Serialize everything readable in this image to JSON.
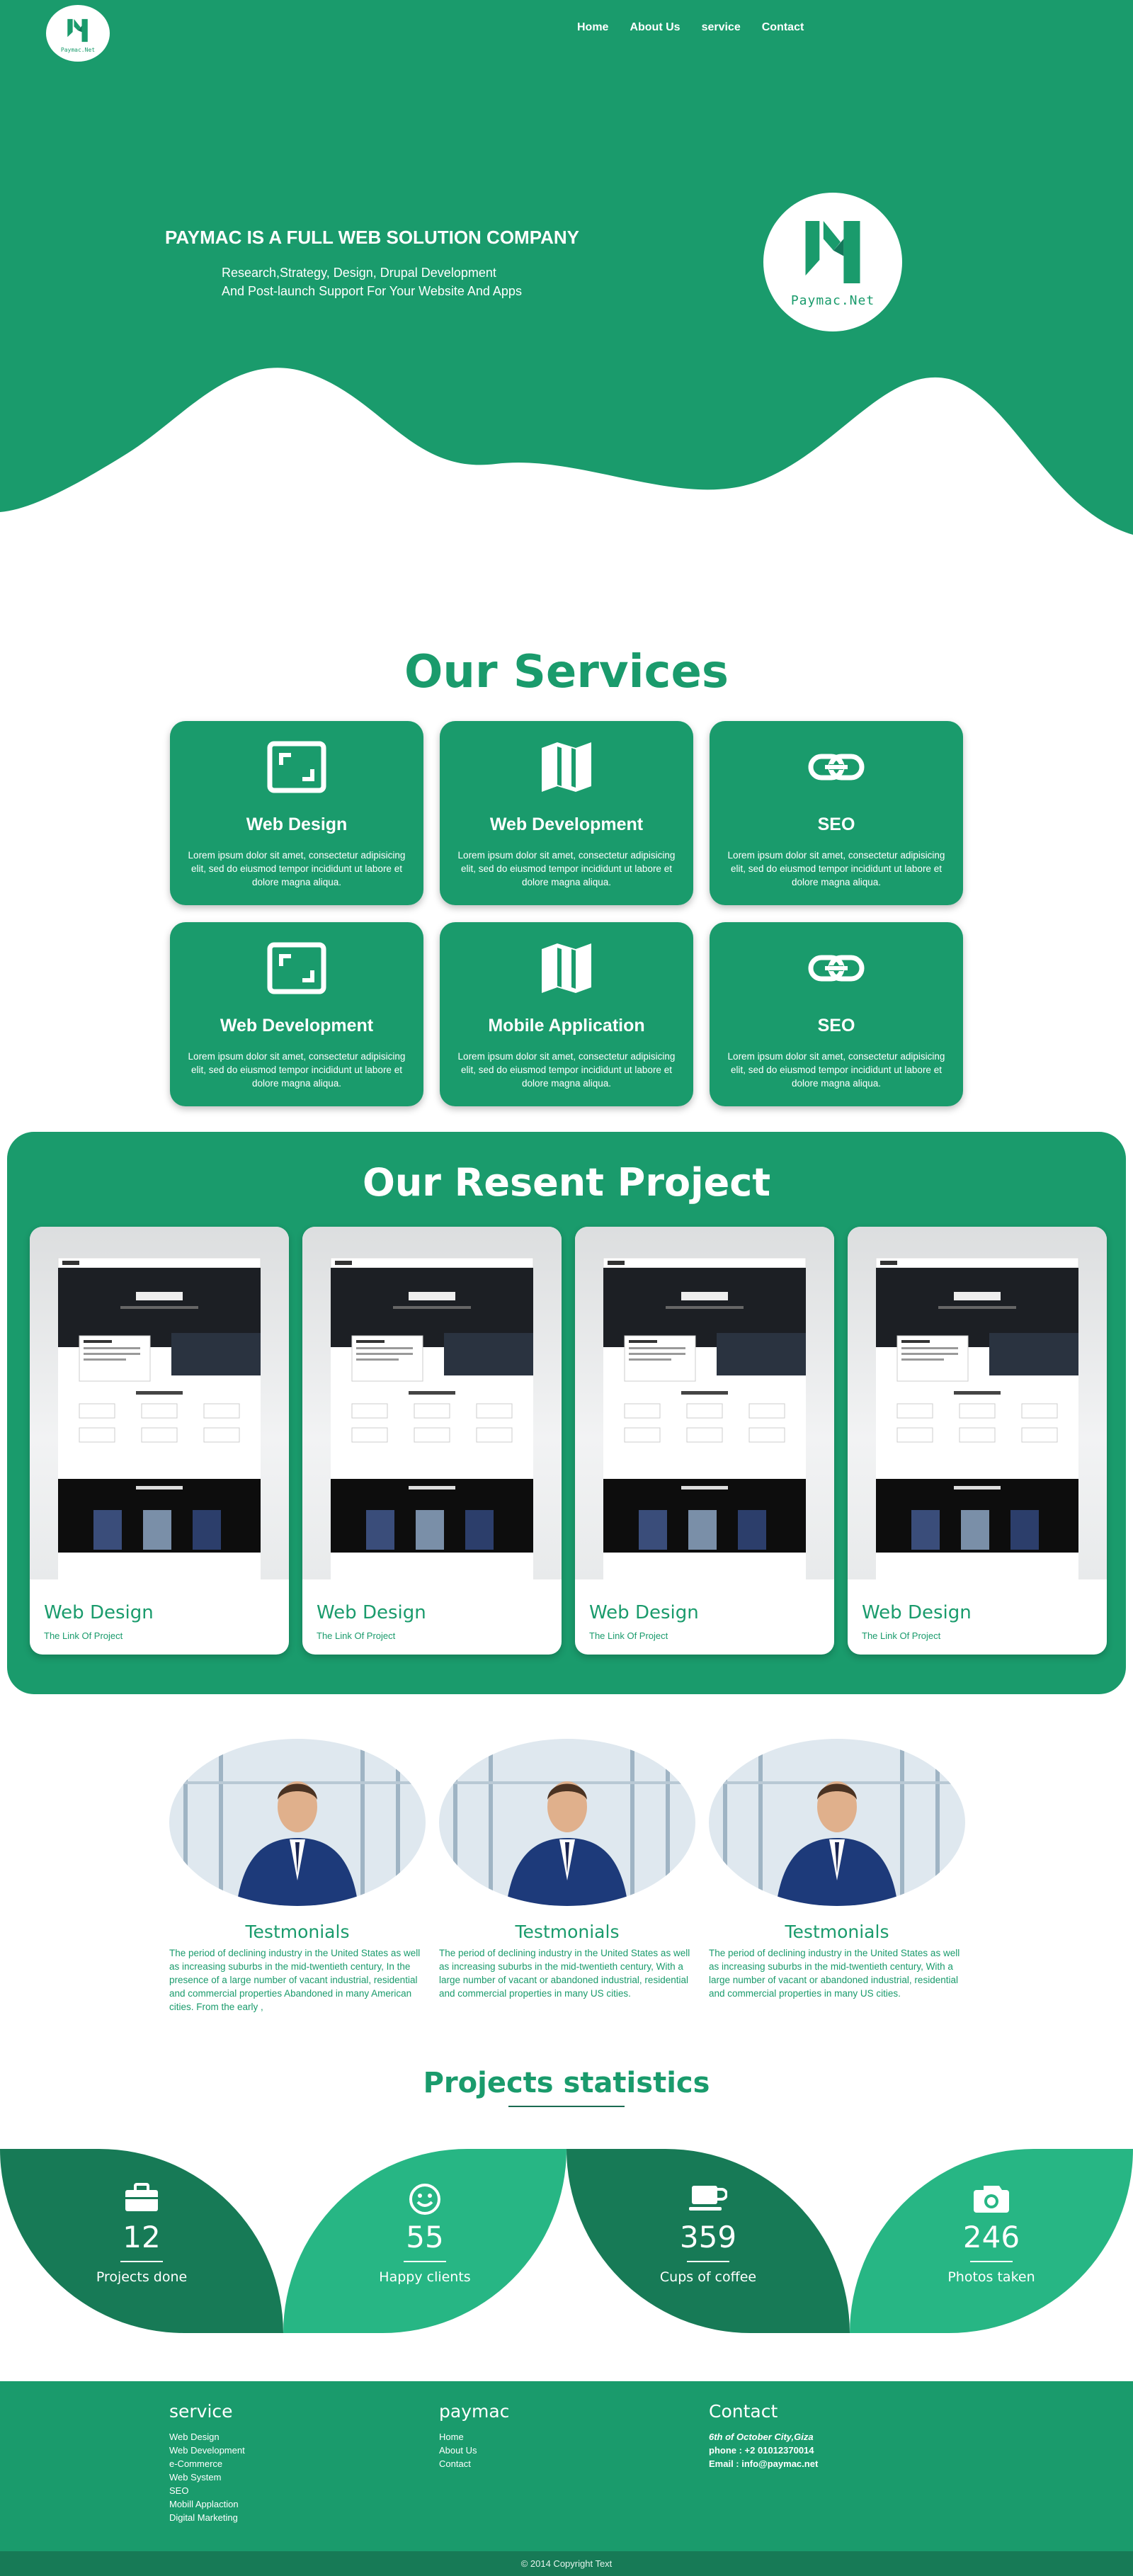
{
  "brand": {
    "logo_text": "Paymac.Net",
    "primary": "#1a9b6c",
    "dark": "#177a56",
    "light": "#27b684"
  },
  "nav": {
    "items": [
      "Home",
      "About Us",
      "service",
      "Contact"
    ]
  },
  "hero": {
    "title": "PAYMAC IS A FULL WEB SOLUTION COMPANY",
    "subtitle_line1": "Research,Strategy, Design, Drupal Development",
    "subtitle_line2": "And Post-launch Support For Your Website And Apps"
  },
  "services": {
    "title": "Our Services",
    "cards": [
      {
        "icon": "frame-icon",
        "title": "Web Design",
        "text": "Lorem ipsum dolor sit amet, consectetur adipisicing elit, sed do eiusmod tempor incididunt ut labore et dolore magna aliqua."
      },
      {
        "icon": "map-icon",
        "title": "Web Development",
        "text": "Lorem ipsum dolor sit amet, consectetur adipisicing elit, sed do eiusmod tempor incididunt ut labore et dolore magna aliqua."
      },
      {
        "icon": "link-icon",
        "title": "SEO",
        "text": "Lorem ipsum dolor sit amet, consectetur adipisicing elit, sed do eiusmod tempor incididunt ut labore et dolore magna aliqua."
      },
      {
        "icon": "frame-icon",
        "title": "Web Development",
        "text": "Lorem ipsum dolor sit amet, consectetur adipisicing elit, sed do eiusmod tempor incididunt ut labore et dolore magna aliqua."
      },
      {
        "icon": "map-icon",
        "title": "Mobile Application",
        "text": "Lorem ipsum dolor sit amet, consectetur adipisicing elit, sed do eiusmod tempor incididunt ut labore et dolore magna aliqua."
      },
      {
        "icon": "link-icon",
        "title": "SEO",
        "text": "Lorem ipsum dolor sit amet, consectetur adipisicing elit, sed do eiusmod tempor incididunt ut labore et dolore magna aliqua."
      }
    ]
  },
  "projects": {
    "title": "Our Resent Project",
    "cards": [
      {
        "title": "Web Design",
        "link": "The Link Of Project"
      },
      {
        "title": "Web Design",
        "link": "The Link Of Project"
      },
      {
        "title": "Web Design",
        "link": "The Link Of Project"
      },
      {
        "title": "Web Design",
        "link": "The Link Of Project"
      }
    ]
  },
  "testimonials": [
    {
      "title": "Testmonials",
      "text": "The period of declining industry in the United States as well as increasing suburbs in the mid-twentieth century, In the presence of a large number of vacant industrial, residential and commercial properties Abandoned in many American cities. From the early ,"
    },
    {
      "title": "Testmonials",
      "text": "The period of declining industry in the United States as well as increasing suburbs in the mid-twentieth century, With a large number of vacant or abandoned industrial, residential and commercial properties in many US cities."
    },
    {
      "title": "Testmonials",
      "text": "The period of declining industry in the United States as well as increasing suburbs in the mid-twentieth century, With a large number of vacant or abandoned industrial, residential and commercial properties in many US cities."
    }
  ],
  "stats": {
    "title": "Projects statistics",
    "items": [
      {
        "icon": "briefcase-icon",
        "number": "12",
        "label": "Projects done"
      },
      {
        "icon": "smile-icon",
        "number": "55",
        "label": "Happy clients"
      },
      {
        "icon": "coffee-cup-icon",
        "number": "359",
        "label": "Cups of coffee"
      },
      {
        "icon": "camera-icon",
        "number": "246",
        "label": "Photos taken"
      }
    ]
  },
  "footer": {
    "service": {
      "title": "service",
      "links": [
        "Web Design",
        "Web Development",
        "e-Commerce",
        "Web System",
        "SEO",
        "Mobill Applaction",
        "Digital Marketing"
      ]
    },
    "paymac": {
      "title": "paymac",
      "links": [
        "Home",
        "About Us",
        "Contact"
      ]
    },
    "contact": {
      "title": "Contact",
      "address": "6th of October City,Giza",
      "phone": "phone : +2 01012370014",
      "email": "Email : info@paymac.net"
    },
    "copyright": "© 2014 Copyright Text"
  }
}
